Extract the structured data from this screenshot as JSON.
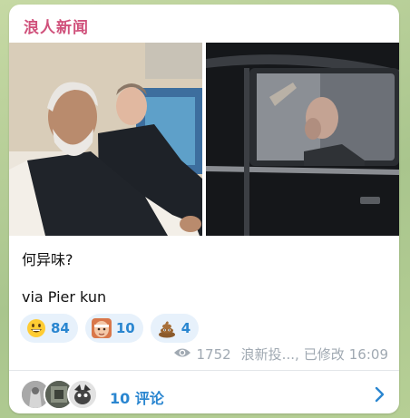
{
  "channel": {
    "title": "浪人新闻"
  },
  "message": {
    "line1": "何异味?",
    "line2": "via Pier kun"
  },
  "reactions": [
    {
      "emoji": "grinning-face",
      "count": "84"
    },
    {
      "emoji": "custom-sticker-face",
      "count": "10"
    },
    {
      "emoji": "pile-of-poo",
      "count": "4"
    }
  ],
  "meta": {
    "views": "1752",
    "author": "浪新投...,",
    "edited": "已修改",
    "time": "16:09"
  },
  "comments": {
    "label": "10 评论"
  },
  "colors": {
    "accent": "#2a86d0",
    "title": "#d0527c",
    "reaction_bg": "#e7f1fb",
    "meta": "#a0a9b2"
  }
}
